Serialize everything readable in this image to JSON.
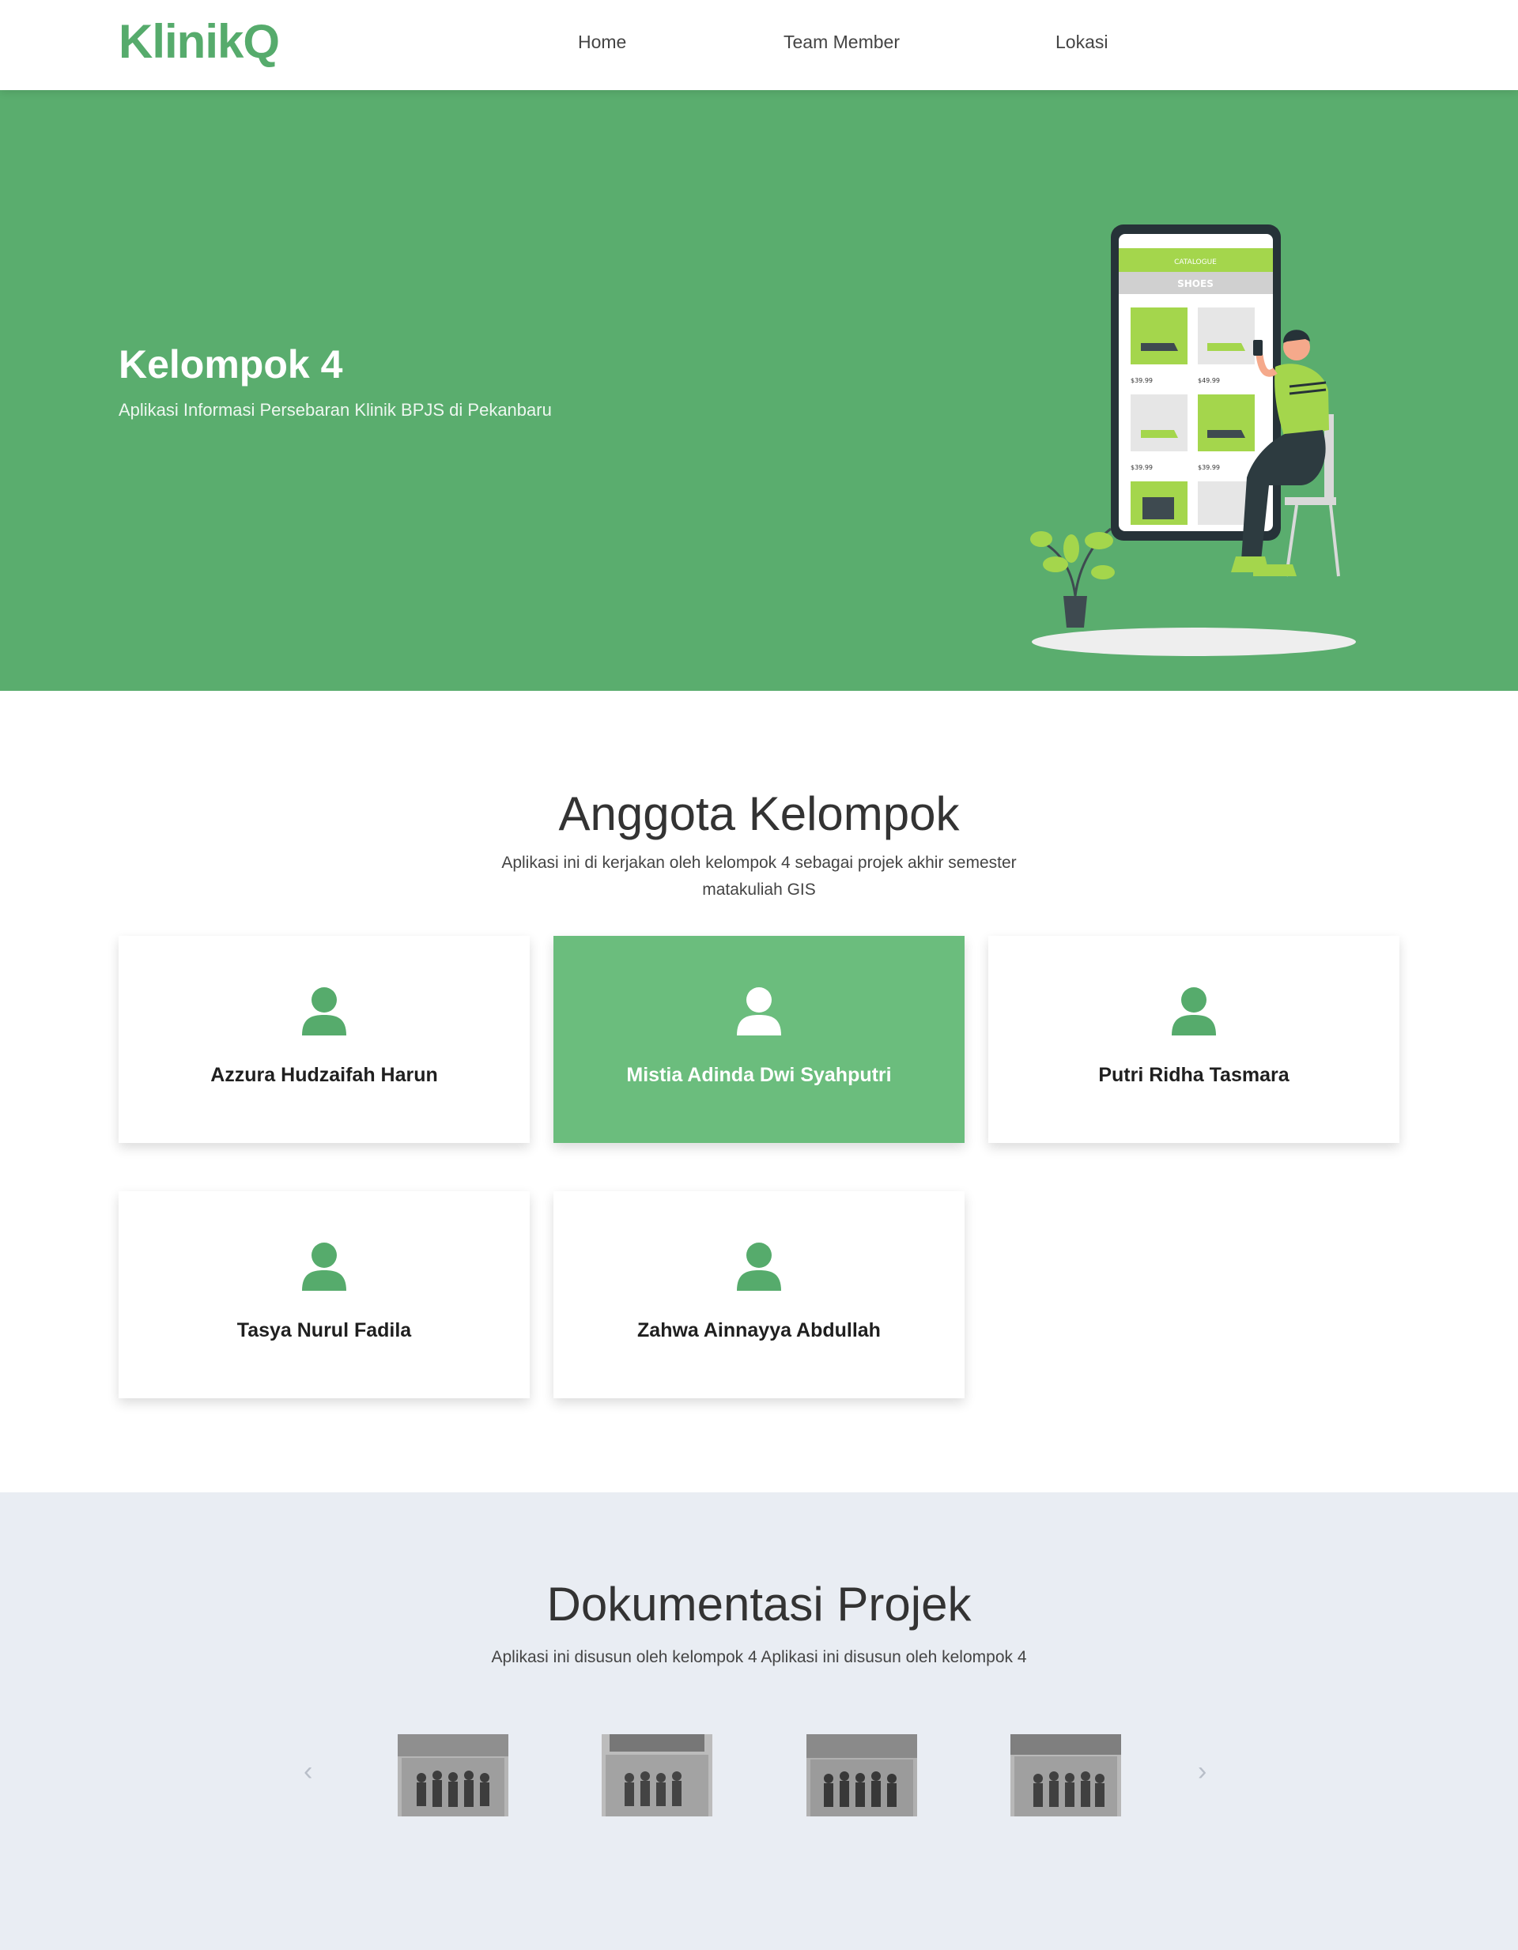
{
  "nav": {
    "brand": "KlinikQ",
    "items": [
      "Home",
      "Team Member",
      "Lokasi"
    ]
  },
  "hero": {
    "title": "Kelompok 4",
    "subtitle": "Aplikasi Informasi Persebaran Klinik BPJS di Pekanbaru",
    "illustration": {
      "header": "CATALOGUE",
      "category": "SHOES",
      "prices": [
        "$39.99",
        "$49.99",
        "$39.99",
        "$39.99"
      ]
    }
  },
  "anggota": {
    "title": "Anggota Kelompok",
    "description": "Aplikasi ini di kerjakan oleh kelompok 4 sebagai projek akhir semester matakuliah GIS",
    "members": [
      {
        "name": "Azzura Hudzaifah Harun"
      },
      {
        "name": "Mistia Adinda Dwi Syahputri"
      },
      {
        "name": "Putri Ridha Tasmara"
      },
      {
        "name": "Tasya Nurul Fadila"
      },
      {
        "name": "Zahwa Ainnayya Abdullah"
      }
    ]
  },
  "dokumentasi": {
    "title": "Dokumentasi Projek",
    "description": "Aplikasi ini disusun oleh kelompok 4 Aplikasi ini disusun oleh kelompok 4",
    "prev": "‹",
    "next": "›"
  },
  "colors": {
    "brand": "#56ab6c",
    "hero_bg": "#5aad6e",
    "card_active": "#6bbd7d",
    "doc_bg": "#e9edf3"
  }
}
